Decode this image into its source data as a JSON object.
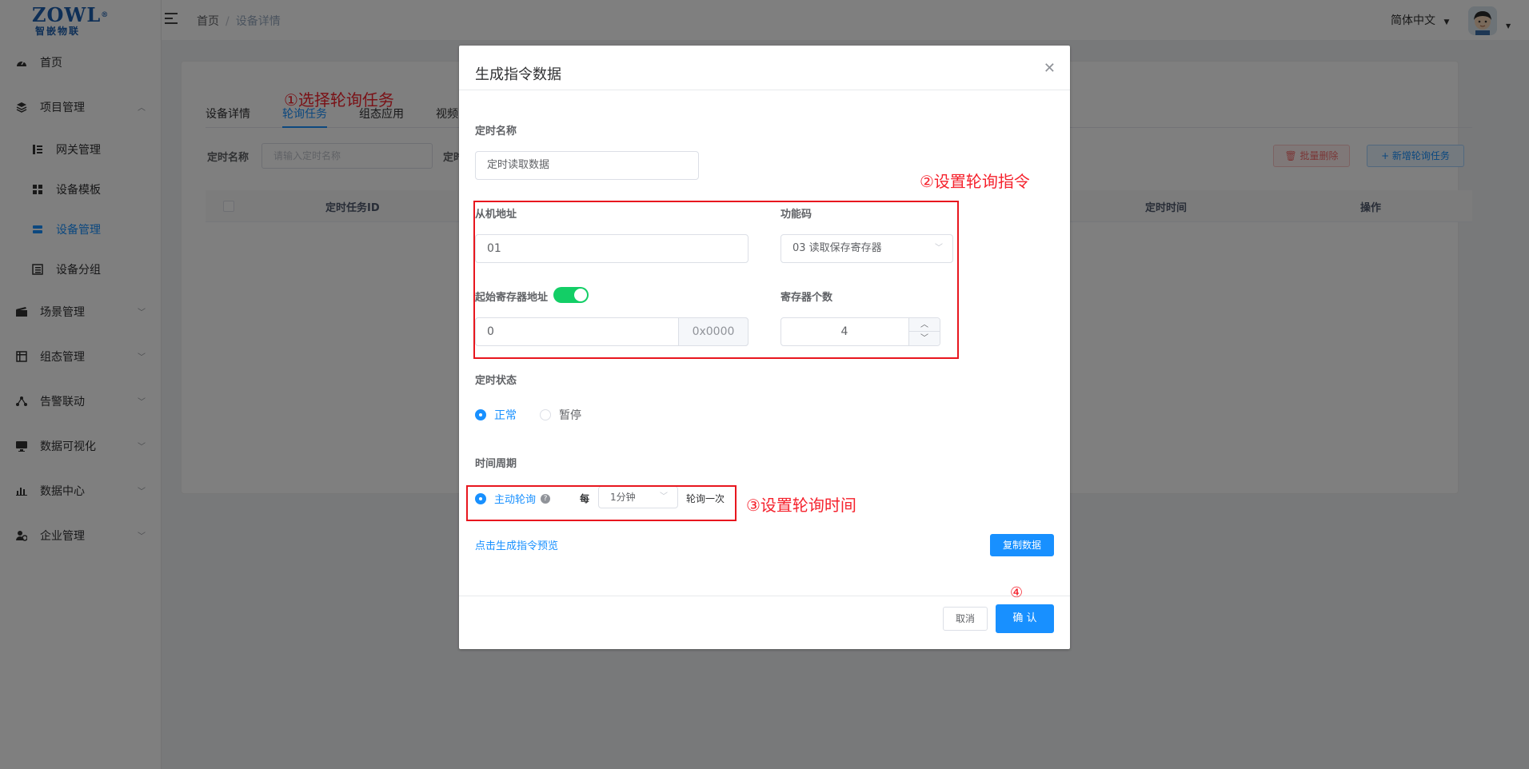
{
  "logo": {
    "brand": "ZOWL",
    "registered": "®",
    "sub": "智嵌物联"
  },
  "sidebar": {
    "items": [
      {
        "label": "首页",
        "icon": "dashboard-icon"
      },
      {
        "label": "项目管理",
        "icon": "layers-icon"
      },
      {
        "label": "网关管理",
        "icon": "tree-list-icon"
      },
      {
        "label": "设备模板",
        "icon": "grid-icon"
      },
      {
        "label": "设备管理",
        "icon": "server-icon"
      },
      {
        "label": "设备分组",
        "icon": "group-list-icon"
      },
      {
        "label": "场景管理",
        "icon": "scene-icon"
      },
      {
        "label": "组态管理",
        "icon": "config-icon"
      },
      {
        "label": "告警联动",
        "icon": "alarm-link-icon"
      },
      {
        "label": "数据可视化",
        "icon": "monitor-icon"
      },
      {
        "label": "数据中心",
        "icon": "bar-chart-icon"
      },
      {
        "label": "企业管理",
        "icon": "enterprise-icon"
      }
    ]
  },
  "header": {
    "breadcrumb": [
      "首页",
      "设备详情"
    ],
    "breadcrumb_sep": "/",
    "language": "简体中文"
  },
  "page": {
    "tabs": [
      "设备详情",
      "轮询任务",
      "组态应用",
      "视频"
    ],
    "filter_label": "定时名称",
    "filter_placeholder": "请输入定时名称",
    "filter_label2": "定时",
    "batch_delete": "批量删除",
    "add_task": "+ 新增轮询任务",
    "table_headers": [
      "定时任务ID",
      "定时时间",
      "操作"
    ]
  },
  "annotations": {
    "step1": "①选择轮询任务",
    "step2": "②设置轮询指令",
    "step3": "③设置轮询时间",
    "step4": "④"
  },
  "dialog": {
    "title": "生成指令数据",
    "timer_name_label": "定时名称",
    "timer_name_value": "定时读取数据",
    "slave_addr_label": "从机地址",
    "slave_addr_value": "01",
    "func_code_label": "功能码",
    "func_code_value": "03 读取保存寄存器",
    "start_reg_label": "起始寄存器地址",
    "start_reg_value": "0",
    "start_reg_hex": "0x0000",
    "reg_count_label": "寄存器个数",
    "reg_count_value": "4",
    "timer_status_label": "定时状态",
    "status_options": [
      "正常",
      "暂停"
    ],
    "status_selected": "正常",
    "period_label": "时间周期",
    "active_poll": "主动轮询",
    "help": "?",
    "every": "每",
    "interval": "1分钟",
    "poll_once": "轮询一次",
    "preview_link": "点击生成指令预览",
    "copy_button": "复制数据",
    "cancel": "取消",
    "confirm": "确 认"
  },
  "colors": {
    "primary": "#1890ff",
    "success": "#13ce66",
    "annotation": "#e8161e"
  }
}
